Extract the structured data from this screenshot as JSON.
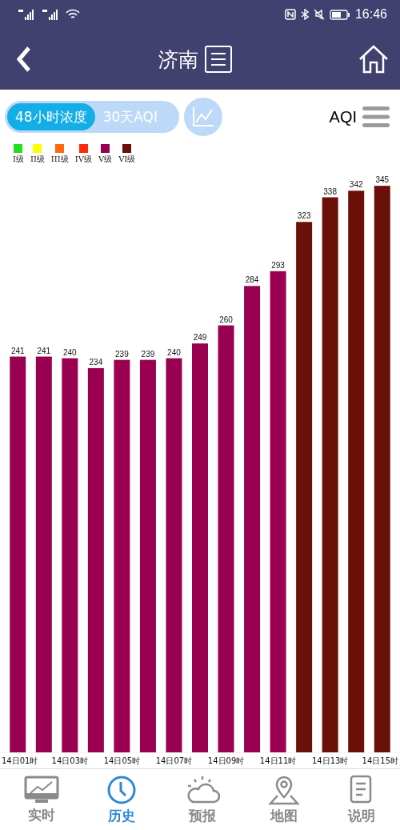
{
  "status_bar": {
    "time": "16:46"
  },
  "header": {
    "title": "济南"
  },
  "toolbar": {
    "tabs": [
      {
        "label": "48小时浓度",
        "selected": true
      },
      {
        "label": "30天AQI",
        "selected": false
      }
    ],
    "metric": "AQI"
  },
  "legend": [
    {
      "label": "I级",
      "color": "#22dd22"
    },
    {
      "label": "II级",
      "color": "#ffff00"
    },
    {
      "label": "III级",
      "color": "#ff6a10"
    },
    {
      "label": "IV级",
      "color": "#ff2a0a"
    },
    {
      "label": "V级",
      "color": "#990050"
    },
    {
      "label": "VI级",
      "color": "#6b1008"
    }
  ],
  "chart_data": {
    "type": "bar",
    "data_labels": true,
    "categories": [
      "14日01时",
      null,
      "14日03时",
      null,
      "14日05时",
      null,
      "14日07时",
      null,
      "14日09时",
      null,
      "14日11时",
      null,
      "14日13时",
      null,
      "14日15时"
    ],
    "series": [
      {
        "color": "#990050",
        "values": [
          241,
          241,
          240,
          234,
          239,
          239,
          240,
          249,
          260,
          284,
          293,
          null,
          null,
          null,
          null
        ]
      },
      {
        "color": "#6b1008",
        "values": [
          null,
          null,
          null,
          null,
          null,
          null,
          null,
          null,
          null,
          null,
          null,
          323,
          338,
          342,
          345
        ]
      }
    ]
  },
  "nav": [
    {
      "label": "实时",
      "selected": false
    },
    {
      "label": "历史",
      "selected": true
    },
    {
      "label": "预报",
      "selected": false
    },
    {
      "label": "地图",
      "selected": false
    },
    {
      "label": "说明",
      "selected": false
    }
  ]
}
